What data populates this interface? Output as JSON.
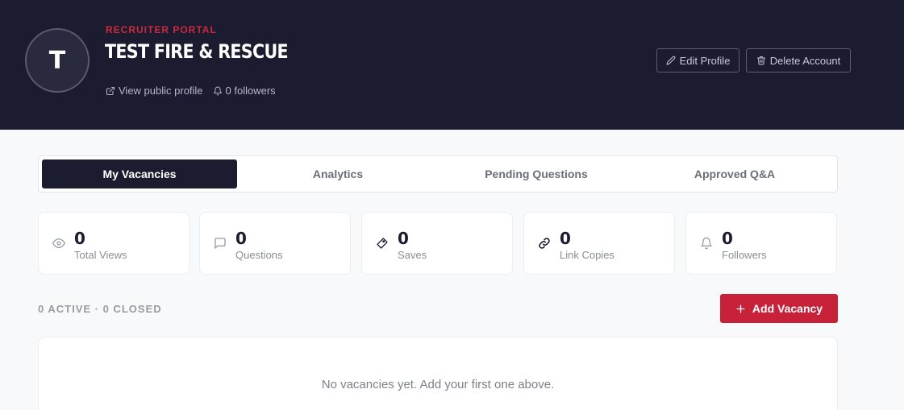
{
  "header": {
    "avatar_initial": "T",
    "portal_label": "RECRUITER PORTAL",
    "org_name": "TEST FIRE & RESCUE",
    "view_profile_label": "View public profile",
    "followers_label": "0 followers",
    "edit_profile_label": "Edit Profile",
    "delete_account_label": "Delete Account"
  },
  "tabs": [
    {
      "label": "My Vacancies",
      "active": true
    },
    {
      "label": "Analytics",
      "active": false
    },
    {
      "label": "Pending Questions",
      "active": false
    },
    {
      "label": "Approved Q&A",
      "active": false
    }
  ],
  "stats": [
    {
      "value": "0",
      "label": "Total Views",
      "icon": "eye-icon"
    },
    {
      "value": "0",
      "label": "Questions",
      "icon": "message-icon"
    },
    {
      "value": "0",
      "label": "Saves",
      "icon": "ticket-icon"
    },
    {
      "value": "0",
      "label": "Link Copies",
      "icon": "link-icon"
    },
    {
      "value": "0",
      "label": "Followers",
      "icon": "bell-icon"
    }
  ],
  "vacancies": {
    "counts_label": "0 ACTIVE · 0 CLOSED",
    "add_button_label": "Add Vacancy",
    "empty_message": "No vacancies yet. Add your first one above."
  },
  "colors": {
    "header_bg": "#1c1c30",
    "accent": "#c8213a",
    "portal_label": "#d0283e"
  }
}
